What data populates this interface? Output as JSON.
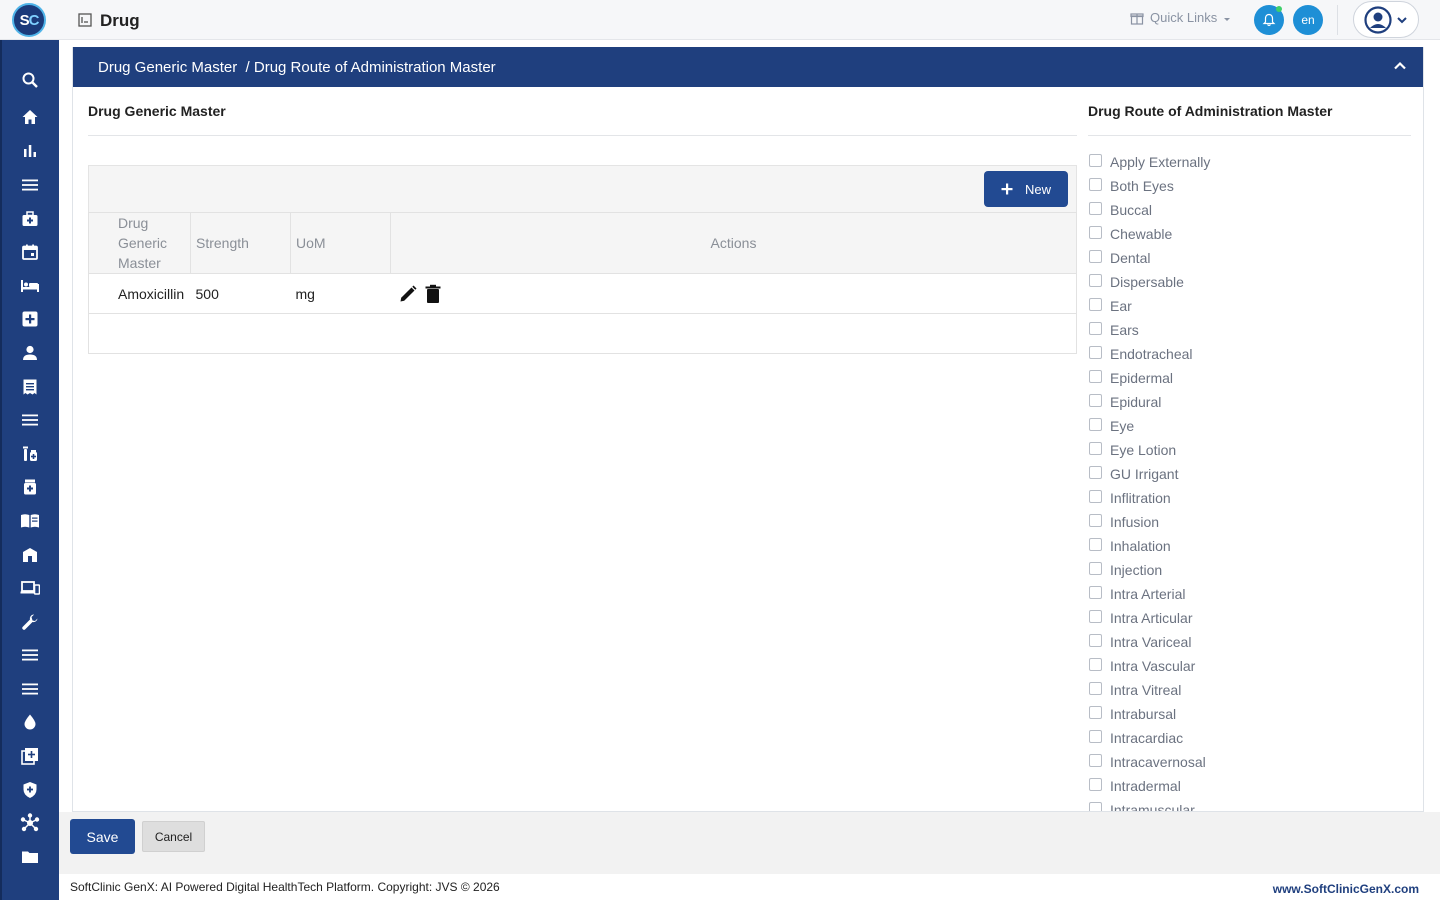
{
  "app": {
    "logo_s": "S",
    "logo_c": "C",
    "page_title": "Drug"
  },
  "topbar": {
    "quick_links": "Quick Links",
    "language": "en"
  },
  "sidebar": {
    "icons": [
      "search-icon",
      "home-icon",
      "bar-chart-icon",
      "menu-icon",
      "medical-bag-icon",
      "calendar-icon",
      "bed-icon",
      "medical-plus-icon",
      "person-icon",
      "receipt-icon",
      "menu-icon",
      "pharmacy-icon",
      "medicine-bottle-icon",
      "book-icon",
      "building-icon",
      "devices-icon",
      "wrench-icon",
      "menu-icon",
      "drop-icon",
      "add-box-icon",
      "shield-icon",
      "hub-icon",
      "folder-icon"
    ]
  },
  "panel": {
    "breadcrumb": "Drug Generic Master  / Drug Route of Administration Master"
  },
  "left": {
    "title": "Drug Generic Master",
    "new_label": "New",
    "columns": {
      "generic_line1": "Drug",
      "generic_line2": "Generic",
      "generic_line3": "Master",
      "strength": "Strength",
      "uom": "UoM",
      "actions": "Actions"
    },
    "rows": [
      {
        "generic": "Amoxicillin",
        "strength": "500",
        "uom": "mg"
      }
    ]
  },
  "right": {
    "title": "Drug Route of Administration Master",
    "routes": [
      "Apply Externally",
      "Both Eyes",
      "Buccal",
      "Chewable",
      "Dental",
      "Dispersable",
      "Ear",
      "Ears",
      "Endotracheal",
      "Epidermal",
      "Epidural",
      "Eye",
      "Eye Lotion",
      "GU Irrigant",
      "Inflitration",
      "Infusion",
      "Inhalation",
      "Injection",
      "Intra Arterial",
      "Intra Articular",
      "Intra Variceal",
      "Intra Vascular",
      "Intra Vitreal",
      "Intrabursal",
      "Intracardiac",
      "Intracavernosal",
      "Intradermal",
      "Intramuscular"
    ]
  },
  "footer": {
    "save_label": "Save",
    "cancel_label": "Cancel",
    "copyright": "SoftClinic GenX: AI Powered Digital HealthTech Platform. Copyright: JVS © 2026",
    "site": "www.SoftClinicGenX.com"
  },
  "colors": {
    "brand_navy": "#1f3f7e",
    "button_blue": "#224a92",
    "notify_blue": "#1e8fd6"
  }
}
